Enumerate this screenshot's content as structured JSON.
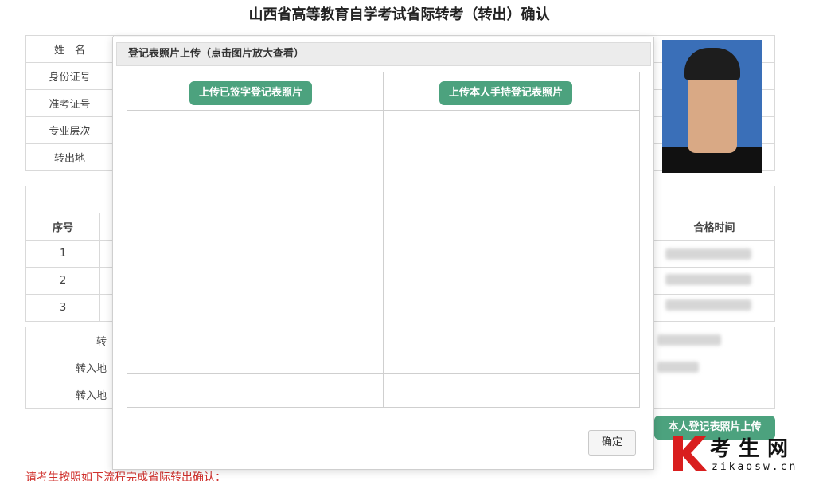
{
  "page": {
    "title": "山西省高等教育自学考试省际转考（转出）确认"
  },
  "info_table": {
    "rows": [
      {
        "label": "姓　名"
      },
      {
        "label": "身份证号"
      },
      {
        "label": "准考证号"
      },
      {
        "label": "专业层次"
      },
      {
        "label": "转出地"
      }
    ]
  },
  "score_table": {
    "col_index": "序号",
    "col_time": "合格时间",
    "rows": [
      "1",
      "2",
      "3"
    ]
  },
  "transfer_table": {
    "rows": [
      {
        "label": "转"
      },
      {
        "label": "转入地"
      },
      {
        "label": "转入地"
      }
    ]
  },
  "upload_main_button": "本人登记表照片上传",
  "notice": "请考生按照如下流程完成省际转出确认：",
  "logo": {
    "cn": "考生网",
    "en": "zikaosw.cn"
  },
  "modal": {
    "header": "登记表照片上传（点击图片放大查看）",
    "btn_signed": "上传已签字登记表照片",
    "btn_handheld": "上传本人手持登记表照片",
    "confirm": "确定"
  },
  "colors": {
    "accent": "#4ca27e",
    "notice": "#d0312d"
  }
}
